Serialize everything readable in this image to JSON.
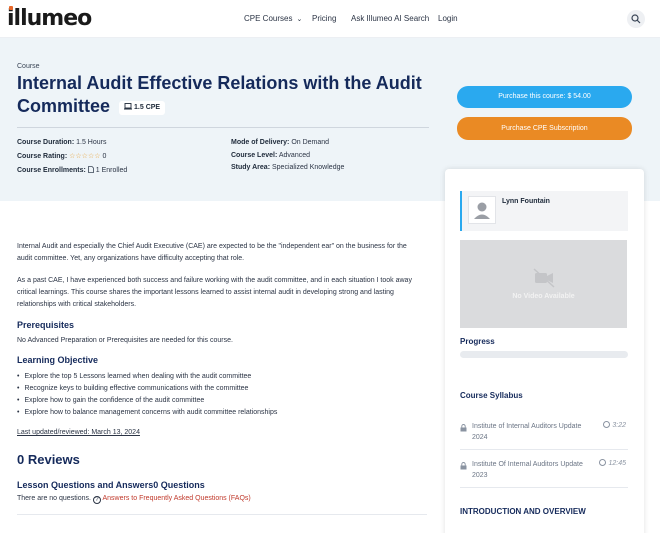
{
  "header": {
    "logo": "illumeo",
    "nav": {
      "cpe_courses": "CPE Courses",
      "pricing": "Pricing",
      "ask": "Ask Illumeo AI Search",
      "login": "Login"
    }
  },
  "course": {
    "crumb": "Course",
    "title": "Internal Audit Effective Relations with the Audit Committee",
    "cpe_badge": "1.5 CPE",
    "meta": {
      "duration_label": "Course Duration:",
      "duration_value": "1.5 Hours",
      "rating_label": "Course Rating:",
      "rating_stars": "☆☆☆☆☆",
      "rating_value": "0",
      "enrollments_label": "Course Enrollments:",
      "enrollments_value": "1 Enrolled",
      "delivery_label": "Mode of Delivery:",
      "delivery_value": "On Demand",
      "level_label": "Course Level:",
      "level_value": "Advanced",
      "study_label": "Study Area:",
      "study_value": "Specialized Knowledge"
    },
    "purchase_button": "Purchase this course: $ 54.00",
    "subscription_button": "Purchase CPE Subscription"
  },
  "body": {
    "para1": "Internal Audit and especially the Chief Audit Executive (CAE) are expected to be the \"independent ear\" on the business for the audit committee.  Yet, any organizations have difficulty accepting that role.",
    "para2": "As a past CAE, I have experienced both success and failure working with the audit committee, and in each situation I took away critical learnings.  This course shares the important lessons learned to assist internal audit in developing strong and lasting relationships with critical stakeholders.",
    "prereq_title": "Prerequisites",
    "prereq_text": "No Advanced Preparation or Prerequisites are needed for this course.",
    "objective_title": "Learning Objective",
    "objectives": [
      "Explore the top 5 Lessons learned when dealing with the audit committee",
      "Recognize keys to building effective communications with the committee",
      "Explore how to gain the confidence of the audit committee",
      "Explore how to balance management concerns with audit committee relationships"
    ],
    "updated": "Last updated/reviewed: March 13, 2024",
    "reviews": "0 Reviews",
    "qa_title": "Lesson Questions and Answers0 Questions",
    "qa_text": "There are no questions.",
    "qa_link": "Answers to Frequently Asked Questions (FAQs)"
  },
  "sidebar": {
    "instructor": "Lynn Fountain",
    "video_text": "No Video Available",
    "progress_label": "Progress",
    "progress_value": 0,
    "syllabus_label": "Course Syllabus",
    "lessons": [
      {
        "title": "Institute of Internal Auditors Update 2024",
        "time": "3:22"
      },
      {
        "title": "Institute Of Internal Auditors Update 2023",
        "time": "12:45"
      }
    ],
    "intro_label": "INTRODUCTION AND OVERVIEW"
  },
  "colors": {
    "primary": "#2aa9ef",
    "orange": "#ea8a24",
    "navy": "#152a5b",
    "hero_bg": "#eef4f8"
  }
}
